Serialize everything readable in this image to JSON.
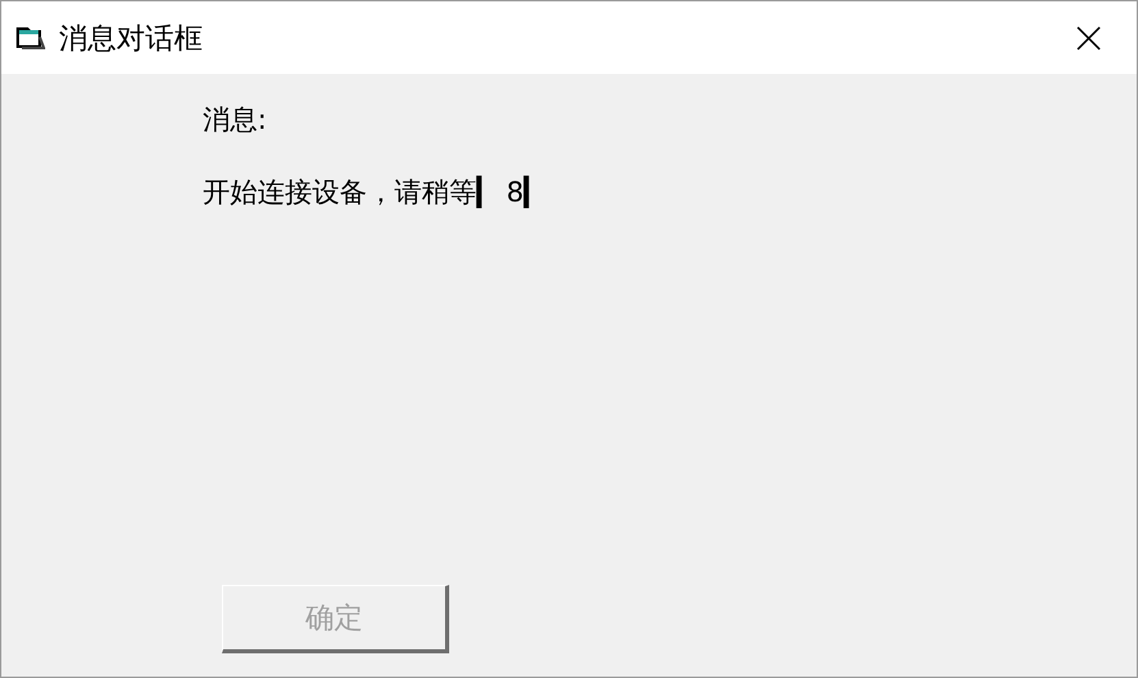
{
  "window": {
    "title": "消息对话框"
  },
  "label": "消息:",
  "message": "开始连接设备，请稍等▎ 8▎",
  "button": {
    "label": "确定",
    "disabled": true
  }
}
